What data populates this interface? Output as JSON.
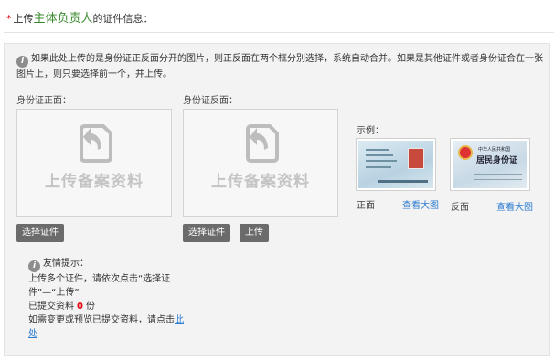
{
  "header": {
    "required_mark": "*",
    "prefix": "上传",
    "emphasis": "主体负责人",
    "suffix": "的证件信息："
  },
  "notice": {
    "icon": "info-icon",
    "text": "如果此处上传的是身份证正反面分开的图片，则正反面在两个框分别选择，系统自动合并。如果是其他证件或者身份证合在一张图片上，则只要选择前一个，并上传。"
  },
  "front": {
    "label": "身份证正面：",
    "placeholder_icon": "upload-doc-icon",
    "placeholder_text": "上传备案资料",
    "choose_button": "选择证件"
  },
  "back": {
    "label": "身份证反面：",
    "placeholder_icon": "upload-doc-icon",
    "placeholder_text": "上传备案资料",
    "choose_button": "选择证件",
    "upload_button": "上传"
  },
  "example": {
    "label": "示例：",
    "front_caption": "正面",
    "back_caption": "反面",
    "view_large": "查看大图",
    "back_card_line1": "中华人民共和国",
    "back_card_line2": "居民身份证"
  },
  "tips": {
    "icon": "info-icon",
    "title": "友情提示：",
    "line1": "上传多个证件，请依次点击“选择证件”—“上传”",
    "submitted_prefix": "已提交资料",
    "submitted_count": "0",
    "submitted_unit": "份",
    "change_prefix": "如需变更或预览已提交资料，请点击",
    "change_link": "此处"
  },
  "colors": {
    "required": "#e60012",
    "emphasis": "#3a8a2e",
    "link": "#2b7bd1",
    "button_bg": "#6b6b6b"
  }
}
